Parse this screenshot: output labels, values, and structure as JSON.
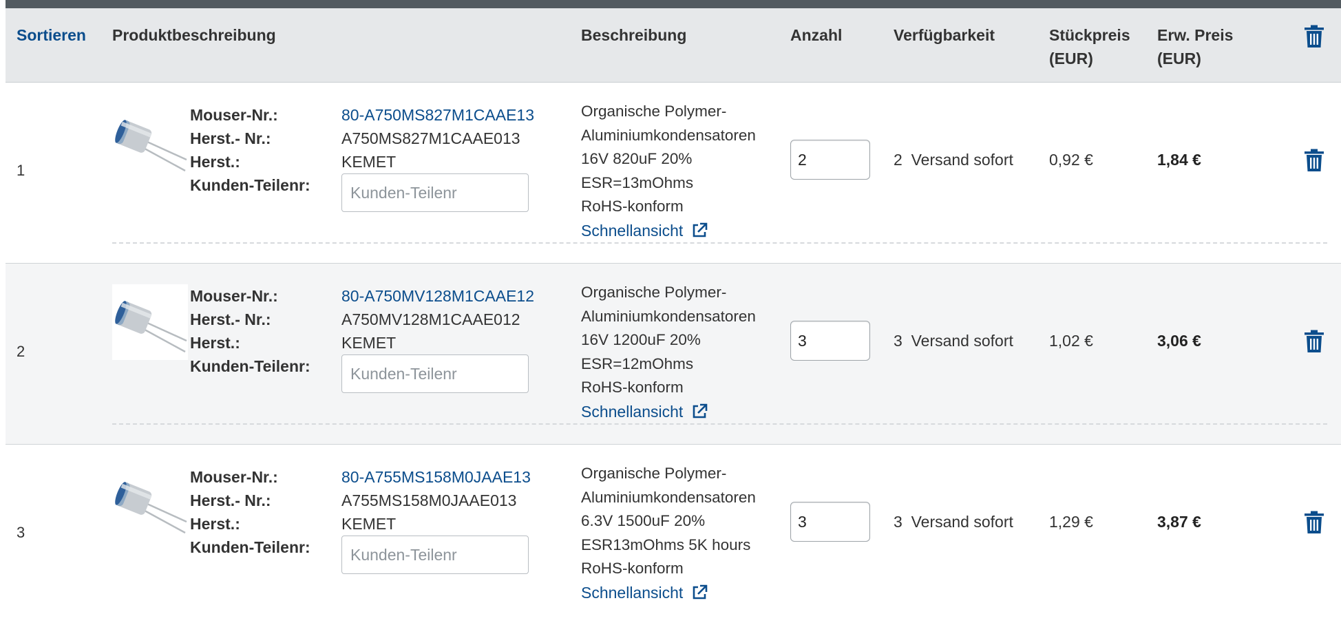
{
  "header": {
    "sort": "Sortieren",
    "product": "Produktbeschreibung",
    "description": "Beschreibung",
    "quantity": "Anzahl",
    "availability": "Verfügbarkeit",
    "unit_price_line1": "Stückpreis",
    "unit_price_line2": "(EUR)",
    "ext_price_line1": "Erw. Preis",
    "ext_price_line2": "(EUR)",
    "delete_all_icon": "trash-icon"
  },
  "labels": {
    "mouser_no": "Mouser-Nr.:",
    "mfr_no": "Herst.- Nr.:",
    "mfr": "Herst.:",
    "customer_no": "Kunden-Teilenr:",
    "customer_placeholder": "Kunden-Teilenr",
    "quick_view": "Schnellansicht"
  },
  "rows": [
    {
      "index": "1",
      "mouser_no": "80-A750MS827M1CAAE13",
      "mfr_no": "A750MS827M1CAAE013",
      "mfr": "KEMET",
      "desc1": "Organische Polymer-",
      "desc2": "Aluminiumkondensatoren",
      "desc3": "16V 820uF 20%",
      "desc4": "ESR=13mOhms",
      "desc5": "RoHS-konform",
      "qty": "2",
      "avail_count": "2",
      "avail_text": "Versand sofort",
      "unit_price": "0,92 €",
      "ext_price": "1,84 €"
    },
    {
      "index": "2",
      "mouser_no": "80-A750MV128M1CAAE12",
      "mfr_no": "A750MV128M1CAAE012",
      "mfr": "KEMET",
      "desc1": "Organische Polymer-",
      "desc2": "Aluminiumkondensatoren",
      "desc3": "16V 1200uF 20%",
      "desc4": "ESR=12mOhms",
      "desc5": "RoHS-konform",
      "qty": "3",
      "avail_count": "3",
      "avail_text": "Versand sofort",
      "unit_price": "1,02 €",
      "ext_price": "3,06 €"
    },
    {
      "index": "3",
      "mouser_no": "80-A755MS158M0JAAE13",
      "mfr_no": "A755MS158M0JAAE013",
      "mfr": "KEMET",
      "desc1": "Organische Polymer-",
      "desc2": "Aluminiumkondensatoren",
      "desc3": "6.3V 1500uF 20%",
      "desc4": "ESR13mOhms 5K hours",
      "desc5": "RoHS-konform",
      "qty": "3",
      "avail_count": "3",
      "avail_text": "Versand sofort",
      "unit_price": "1,29 €",
      "ext_price": "3,87 €"
    }
  ],
  "colors": {
    "link": "#0b4d8c",
    "header_bg": "#e6e8ea",
    "top_bar": "#535b61",
    "alt_row_bg": "#f4f5f6"
  }
}
